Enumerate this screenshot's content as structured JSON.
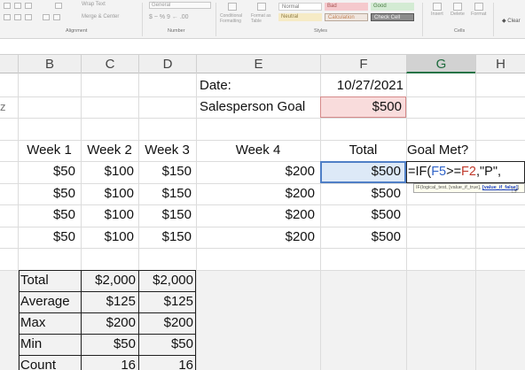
{
  "ribbon": {
    "wrap_text": "Wrap Text",
    "merge_center": "Merge & Center",
    "number_format": "General",
    "number_symbols": "$ ~ % 9 ← .00",
    "conditional_formatting": "Conditional Formatting",
    "format_as_table": "Format as Table",
    "insert": "Insert",
    "delete": "Delete",
    "format": "Format",
    "clear": "Clear",
    "groups": {
      "alignment": "Alignment",
      "number": "Number",
      "styles": "Styles",
      "cells": "Cells"
    },
    "styles": {
      "normal": "Normal",
      "bad": "Bad",
      "good": "Good",
      "neutral": "Neutral",
      "calculation": "Calculation",
      "check_cell": "Check Cell"
    }
  },
  "columns": [
    "B",
    "C",
    "D",
    "E",
    "F",
    "G",
    "H"
  ],
  "selected_column": "G",
  "cells": {
    "e3": "Date:",
    "f3": "10/27/2021",
    "e4": "Salesperson Goal",
    "f4": "$500",
    "headers": {
      "b": "Week 1",
      "c": "Week 2",
      "d": "Week 3",
      "e": "Week 4",
      "f": "Total",
      "g": "Goal Met?"
    },
    "rows": [
      {
        "b": "$50",
        "c": "$100",
        "d": "$150",
        "e": "$200",
        "f": "$500"
      },
      {
        "b": "$50",
        "c": "$100",
        "d": "$150",
        "e": "$200",
        "f": "$500"
      },
      {
        "b": "$50",
        "c": "$100",
        "d": "$150",
        "e": "$200",
        "f": "$500"
      },
      {
        "b": "$50",
        "c": "$100",
        "d": "$150",
        "e": "$200",
        "f": "$500"
      }
    ],
    "summary": [
      {
        "label": "Total",
        "c": "$2,000",
        "d": "$2,000"
      },
      {
        "label": "Average",
        "c": "$125",
        "d": "$125"
      },
      {
        "label": "Max",
        "c": "$200",
        "d": "$200"
      },
      {
        "label": "Min",
        "c": "$50",
        "d": "$50"
      },
      {
        "label": "Count",
        "c": "16",
        "d": "16"
      }
    ]
  },
  "formula": {
    "prefix": "=IF(",
    "ref1": "F5",
    "op": ">=",
    "ref2": "F2",
    "suffix": ",\"P\","
  },
  "tooltip": {
    "text": "IF(logical_test, [value_if_true], ",
    "highlight": "[value_if_false]",
    "end": ")"
  },
  "colors": {
    "ref1": "#2e62c7",
    "ref2": "#c0392b",
    "goal_fill": "#f9dcdc",
    "selected_col": "#217346"
  }
}
